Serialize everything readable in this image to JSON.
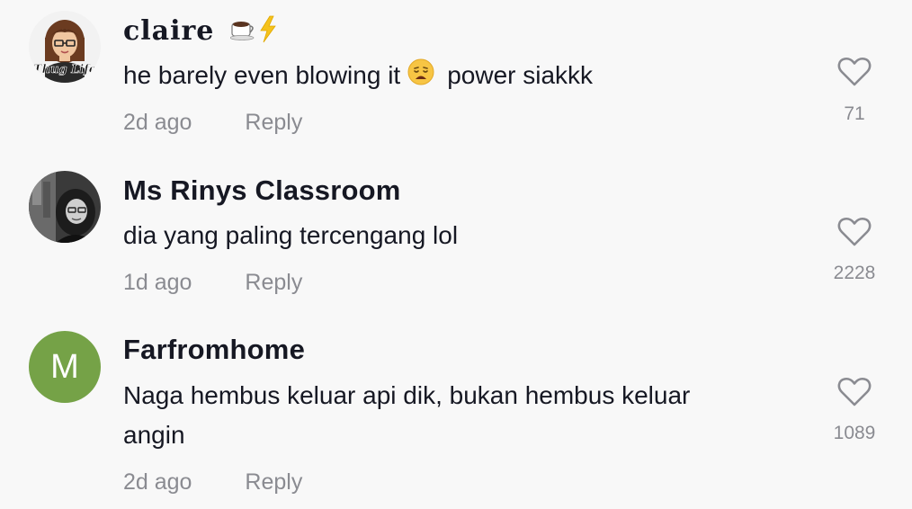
{
  "comments": [
    {
      "username": "claire",
      "username_emoji": "☕⚡",
      "text_before": "he barely even blowing it",
      "text_after": "power siakkk",
      "time": "2d ago",
      "reply_label": "Reply",
      "likes": "71",
      "avatar_caption": "Thug Life"
    },
    {
      "username": "Ms Rinys Classroom",
      "text": "dia yang paling tercengang lol",
      "time": "1d ago",
      "reply_label": "Reply",
      "likes": "2228"
    },
    {
      "username": "Farfromhome",
      "avatar_initial": "M",
      "avatar_color": "#75a247",
      "text_line1": "Naga hembus keluar api dik, bukan hembus keluar",
      "text_line2": "angin",
      "time": "2d ago",
      "reply_label": "Reply",
      "likes": "1089"
    }
  ],
  "icons": {
    "like": "heart-outline-icon",
    "emoji_weary": "weary-face-emoji"
  }
}
